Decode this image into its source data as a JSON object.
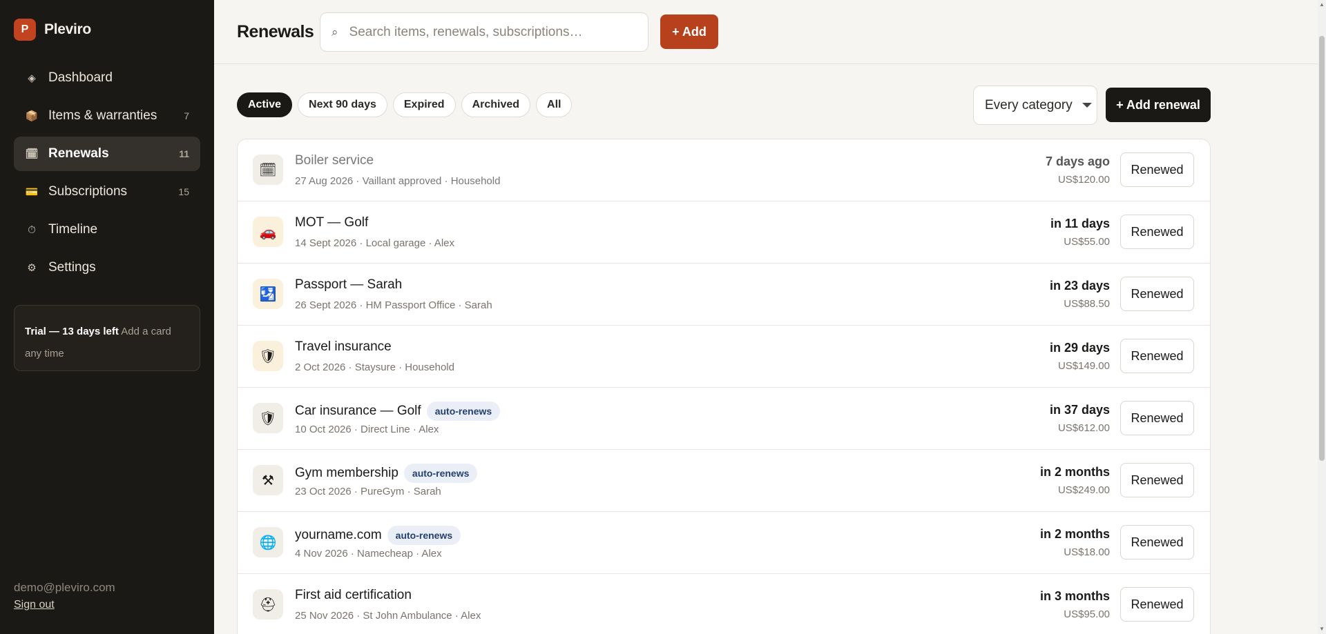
{
  "brand": {
    "logo_letter": "P",
    "name": "Pleviro",
    "accent": "#c2431f"
  },
  "sidebar": {
    "items": [
      {
        "icon": "diamond-icon",
        "glyph": "◈",
        "label": "Dashboard",
        "count": ""
      },
      {
        "icon": "box-icon",
        "glyph": "📦",
        "label": "Items & warranties",
        "count": "7"
      },
      {
        "icon": "calendar-icon",
        "glyph": "🗓",
        "label": "Renewals",
        "count": "11"
      },
      {
        "icon": "card-icon",
        "glyph": "💳",
        "label": "Subscriptions",
        "count": "15"
      },
      {
        "icon": "stopwatch-icon",
        "glyph": "⏱",
        "label": "Timeline",
        "count": ""
      },
      {
        "icon": "gear-icon",
        "glyph": "⚙",
        "label": "Settings",
        "count": ""
      }
    ],
    "active_index": 2,
    "trial": {
      "title": "Trial — 13 days left",
      "note": "Add a card any time"
    },
    "account": {
      "email": "demo@pleviro.com",
      "sign_out": "Sign out"
    }
  },
  "header": {
    "title": "Renewals",
    "search_placeholder": "Search items, renewals, subscriptions…",
    "add_label": "+ Add"
  },
  "filters": {
    "pills": [
      "Active",
      "Next 90 days",
      "Expired",
      "Archived",
      "All"
    ],
    "active_index": 0,
    "category": "Every category",
    "add_renewal": "+ Add renewal"
  },
  "renewals": [
    {
      "icon": "calendar-icon",
      "glyph": "🗓",
      "warm": false,
      "dim": true,
      "title": "Boiler service",
      "badge": "",
      "meta": "27 Aug 2026 · Vaillant approved · Household",
      "due": "7 days ago",
      "price": "US$120.00",
      "action": "Renewed"
    },
    {
      "icon": "car-icon",
      "glyph": "🚗",
      "warm": true,
      "dim": false,
      "title": "MOT — Golf",
      "badge": "",
      "meta": "14 Sept 2026 · Local garage · Alex",
      "due": "in 11 days",
      "price": "US$55.00",
      "action": "Renewed"
    },
    {
      "icon": "passport-icon",
      "glyph": "🛂",
      "warm": true,
      "dim": false,
      "title": "Passport — Sarah",
      "badge": "",
      "meta": "26 Sept 2026 · HM Passport Office · Sarah",
      "due": "in 23 days",
      "price": "US$88.50",
      "action": "Renewed"
    },
    {
      "icon": "shield-icon",
      "glyph": "🛡",
      "warm": true,
      "dim": false,
      "title": "Travel insurance",
      "badge": "",
      "meta": "2 Oct 2026 · Staysure · Household",
      "due": "in 29 days",
      "price": "US$149.00",
      "action": "Renewed"
    },
    {
      "icon": "shield-icon",
      "glyph": "🛡",
      "warm": false,
      "dim": false,
      "title": "Car insurance — Golf",
      "badge": "auto-renews",
      "meta": "10 Oct 2026 · Direct Line · Alex",
      "due": "in 37 days",
      "price": "US$612.00",
      "action": "Renewed"
    },
    {
      "icon": "dumbbell-icon",
      "glyph": "⚒",
      "warm": false,
      "dim": false,
      "title": "Gym membership",
      "badge": "auto-renews",
      "meta": "23 Oct 2026 · PureGym · Sarah",
      "due": "in 2 months",
      "price": "US$249.00",
      "action": "Renewed"
    },
    {
      "icon": "globe-icon",
      "glyph": "🌐",
      "warm": false,
      "dim": false,
      "title": "yourname.com",
      "badge": "auto-renews",
      "meta": "4 Nov 2026 · Namecheap · Alex",
      "due": "in 2 months",
      "price": "US$18.00",
      "action": "Renewed"
    },
    {
      "icon": "kit-icon",
      "glyph": "⛑",
      "warm": false,
      "dim": false,
      "title": "First aid certification",
      "badge": "",
      "meta": "25 Nov 2026 · St John Ambulance · Alex",
      "due": "in 3 months",
      "price": "US$95.00",
      "action": "Renewed"
    }
  ]
}
